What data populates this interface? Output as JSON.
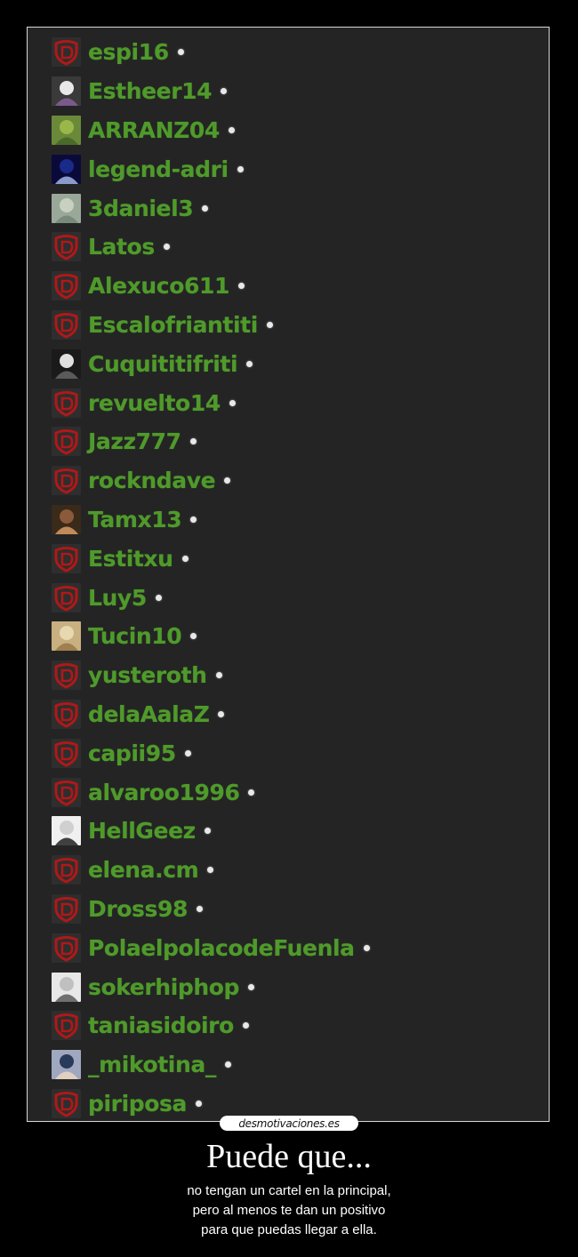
{
  "users": [
    {
      "name": "espi16",
      "avatar": "default-shield-icon"
    },
    {
      "name": "Estheer14",
      "avatar": "custom-photo-icon"
    },
    {
      "name": "ARRANZ04",
      "avatar": "custom-photo-icon"
    },
    {
      "name": "legend-adri",
      "avatar": "custom-photo-icon"
    },
    {
      "name": "3daniel3",
      "avatar": "custom-photo-icon"
    },
    {
      "name": "Latos",
      "avatar": "default-shield-icon"
    },
    {
      "name": "Alexuco611",
      "avatar": "default-shield-icon"
    },
    {
      "name": "Escalofriantiti",
      "avatar": "default-shield-icon"
    },
    {
      "name": "Cuquititifriti",
      "avatar": "custom-photo-icon"
    },
    {
      "name": "revuelto14",
      "avatar": "default-shield-icon"
    },
    {
      "name": "Jazz777",
      "avatar": "default-shield-icon"
    },
    {
      "name": "rockndave",
      "avatar": "default-shield-icon"
    },
    {
      "name": "Tamx13",
      "avatar": "custom-photo-icon"
    },
    {
      "name": "Estitxu",
      "avatar": "default-shield-icon"
    },
    {
      "name": "Luy5",
      "avatar": "default-shield-icon"
    },
    {
      "name": "Tucin10",
      "avatar": "custom-photo-icon"
    },
    {
      "name": "yusteroth",
      "avatar": "default-shield-icon"
    },
    {
      "name": "delaAalaZ",
      "avatar": "default-shield-icon"
    },
    {
      "name": "capii95",
      "avatar": "default-shield-icon"
    },
    {
      "name": "alvaroo1996",
      "avatar": "default-shield-icon"
    },
    {
      "name": "HellGeez",
      "avatar": "custom-photo-icon"
    },
    {
      "name": "elena.cm",
      "avatar": "default-shield-icon"
    },
    {
      "name": "Dross98",
      "avatar": "default-shield-icon"
    },
    {
      "name": "PolaelpolacodeFuenla",
      "avatar": "default-shield-icon"
    },
    {
      "name": "sokerhiphop",
      "avatar": "custom-photo-icon"
    },
    {
      "name": "taniasidoiro",
      "avatar": "default-shield-icon"
    },
    {
      "name": "_mikotina_",
      "avatar": "custom-photo-icon"
    },
    {
      "name": "piriposa",
      "avatar": "default-shield-icon"
    }
  ],
  "watermark": "desmotivaciones.es",
  "caption": {
    "title": "Puede que...",
    "lines": [
      "no tengan un cartel en la principal,",
      "pero al menos te dan un positivo",
      "para que puedas llegar a ella."
    ]
  },
  "colors": {
    "username": "#4f9a2b",
    "panel": "#242424",
    "shield": "#b01818"
  }
}
